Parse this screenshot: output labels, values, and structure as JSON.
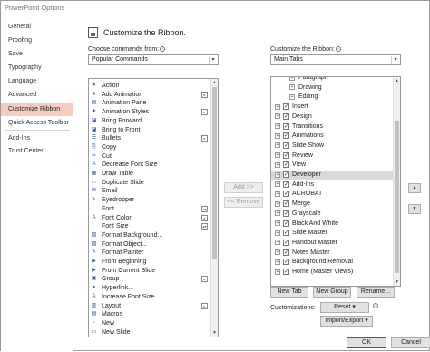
{
  "window": {
    "title": "PowerPoint Options"
  },
  "nav": {
    "items": [
      {
        "label": "General",
        "active": false
      },
      {
        "label": "Proofing",
        "active": false
      },
      {
        "label": "Save",
        "active": false
      },
      {
        "label": "Typography",
        "active": false
      },
      {
        "label": "Language",
        "active": false
      },
      {
        "label": "Advanced",
        "active": false
      },
      {
        "label": "Customize Ribbon",
        "active": true
      },
      {
        "label": "Quick Access Toolbar",
        "active": false
      },
      {
        "label": "Add-Ins",
        "active": false
      },
      {
        "label": "Trust Center",
        "active": false
      }
    ]
  },
  "header": {
    "title": "Customize the Ribbon."
  },
  "left": {
    "label": "Choose commands from:",
    "selected": "Popular Commands",
    "commands": [
      {
        "label": "Action",
        "icon": "★"
      },
      {
        "label": "Add Animation",
        "icon": "★",
        "sub": true
      },
      {
        "label": "Animation Pane",
        "icon": "▤"
      },
      {
        "label": "Animation Styles",
        "icon": "★",
        "sub": true
      },
      {
        "label": "Bring Forward",
        "icon": "◪"
      },
      {
        "label": "Bring to Front",
        "icon": "◪"
      },
      {
        "label": "Bullets",
        "icon": "☰",
        "sub": true
      },
      {
        "label": "Copy",
        "icon": "⎘"
      },
      {
        "label": "Cut",
        "icon": "✂"
      },
      {
        "label": "Decrease Font Size",
        "icon": "A"
      },
      {
        "label": "Draw Table",
        "icon": "▦"
      },
      {
        "label": "Duplicate Slide",
        "icon": "▭"
      },
      {
        "label": "Email",
        "icon": "✉"
      },
      {
        "label": "Eyedropper",
        "icon": "✎"
      },
      {
        "label": "Font",
        "icon": "",
        "sub": "field"
      },
      {
        "label": "Font Color",
        "icon": "A",
        "sub": true
      },
      {
        "label": "Font Size",
        "icon": "",
        "sub": "field"
      },
      {
        "label": "Format Background...",
        "icon": "▧"
      },
      {
        "label": "Format Object...",
        "icon": "▧"
      },
      {
        "label": "Format Painter",
        "icon": "✎"
      },
      {
        "label": "From Beginning",
        "icon": "▶"
      },
      {
        "label": "From Current Slide",
        "icon": "▶"
      },
      {
        "label": "Group",
        "icon": "▣",
        "sub": true
      },
      {
        "label": "Hyperlink...",
        "icon": "⚭"
      },
      {
        "label": "Increase Font Size",
        "icon": "A"
      },
      {
        "label": "Layout",
        "icon": "▥",
        "sub": true
      },
      {
        "label": "Macros",
        "icon": "▤"
      },
      {
        "label": "New",
        "icon": "▫"
      },
      {
        "label": "New Slide",
        "icon": "▭"
      }
    ]
  },
  "mid": {
    "add_label": "Add >>",
    "remove_label": "<< Remove"
  },
  "right": {
    "label": "Customize the Ribbon:",
    "selected": "Main Tabs",
    "tabs": [
      {
        "label": "Paragraph",
        "level": 2,
        "expander": "+",
        "checkbox": false
      },
      {
        "label": "Drawing",
        "level": 2,
        "expander": "+",
        "checkbox": false
      },
      {
        "label": "Editing",
        "level": 2,
        "expander": "+",
        "checkbox": false
      },
      {
        "label": "Insert",
        "level": 1,
        "expander": "+",
        "checkbox": true,
        "checked": true
      },
      {
        "label": "Design",
        "level": 1,
        "expander": "+",
        "checkbox": true,
        "checked": true
      },
      {
        "label": "Transitions",
        "level": 1,
        "expander": "+",
        "checkbox": true,
        "checked": true
      },
      {
        "label": "Animations",
        "level": 1,
        "expander": "+",
        "checkbox": true,
        "checked": true
      },
      {
        "label": "Slide Show",
        "level": 1,
        "expander": "+",
        "checkbox": true,
        "checked": true
      },
      {
        "label": "Review",
        "level": 1,
        "expander": "+",
        "checkbox": true,
        "checked": true
      },
      {
        "label": "View",
        "level": 1,
        "expander": "+",
        "checkbox": true,
        "checked": true
      },
      {
        "label": "Developer",
        "level": 1,
        "expander": "+",
        "checkbox": true,
        "checked": true,
        "selected": true
      },
      {
        "label": "Add-Ins",
        "level": 1,
        "expander": "+",
        "checkbox": true,
        "checked": true
      },
      {
        "label": "ACROBAT",
        "level": 1,
        "expander": "+",
        "checkbox": true,
        "checked": true
      },
      {
        "label": "Merge",
        "level": 1,
        "expander": "+",
        "checkbox": true,
        "checked": true
      },
      {
        "label": "Grayscale",
        "level": 1,
        "expander": "+",
        "checkbox": true,
        "checked": true
      },
      {
        "label": "Black And White",
        "level": 1,
        "expander": "+",
        "checkbox": true,
        "checked": true
      },
      {
        "label": "Slide Master",
        "level": 1,
        "expander": "+",
        "checkbox": true,
        "checked": true
      },
      {
        "label": "Handout Master",
        "level": 1,
        "expander": "+",
        "checkbox": true,
        "checked": true
      },
      {
        "label": "Notes Master",
        "level": 1,
        "expander": "+",
        "checkbox": true,
        "checked": true
      },
      {
        "label": "Background Removal",
        "level": 1,
        "expander": "+",
        "checkbox": true,
        "checked": true
      },
      {
        "label": "Home (Master Views)",
        "level": 1,
        "expander": "+",
        "checkbox": true,
        "checked": true
      }
    ],
    "new_tab": "New Tab",
    "new_group": "New Group",
    "rename": "Rename...",
    "customizations_label": "Customizations:",
    "reset": "Reset",
    "import_export": "Import/Export"
  },
  "footer": {
    "ok": "OK",
    "cancel": "Cancel"
  }
}
